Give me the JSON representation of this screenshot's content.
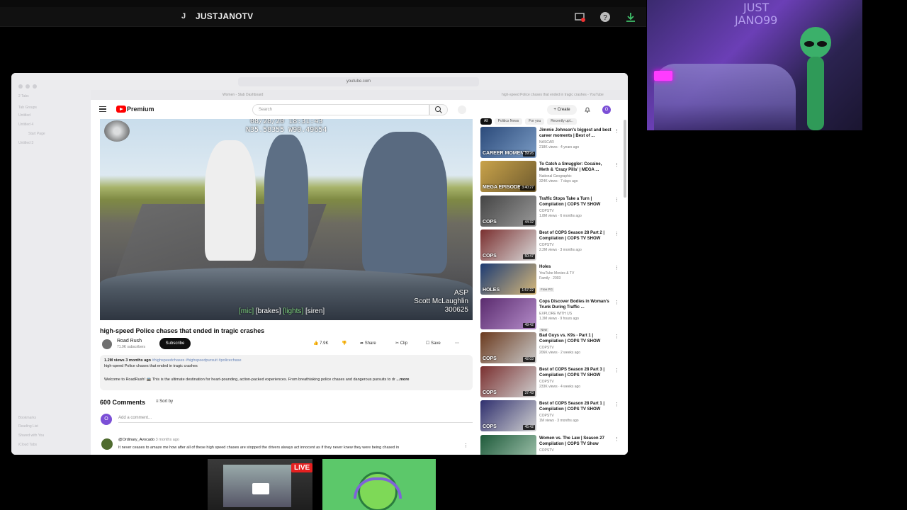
{
  "stream": {
    "channel_initial": "J",
    "channel_name": "JUSTJANOTV",
    "webcam_sign": "JUST\nJANO99",
    "live_label": "LIVE"
  },
  "browser": {
    "url": "youtube.com",
    "tabs": [
      "Women - Slab Dashboard",
      "high-speed Police chases that ended in tragic crashes - YouTube"
    ],
    "sidebar": [
      "2 Tabs",
      "Tab Groups",
      "Untitled",
      "Untitled 4",
      "Start Page",
      "Untitled 3",
      "Bookmarks",
      "Reading List",
      "Shared with You",
      "iCloud Tabs"
    ]
  },
  "youtube": {
    "brand": "Premium",
    "search_placeholder": "Search",
    "create_label": "Create",
    "avatar_initial": "O",
    "video": {
      "overlay_timestamp": "08/28/20 18:31:43",
      "overlay_gps": "N35.58355 W90.49654",
      "overlay_agency": "ASP",
      "overlay_officer": "Scott McLaughlin",
      "overlay_id": "300625",
      "captions": [
        "[mic]",
        "[brakes]",
        "[lights]",
        "[siren]"
      ],
      "title": "high-speed Police chases that ended in tragic crashes",
      "channel": "Road Rush",
      "subscribers": "71.9K subscribers",
      "subscribe_label": "Subscribe",
      "likes": "7.9K",
      "share_label": "Share",
      "clip_label": "Clip",
      "save_label": "Save",
      "views_age": "1.2M views  3 months ago",
      "hashtags": "#highspeedchases #highspeedpursuit #policechase",
      "desc_line2": "high-speed Police chases that ended in tragic crashes",
      "desc_line3": "Welcome to RoadRush! 🚔 This is the ultimate destination for heart-pounding, action-packed experiences. From breathtaking police chases and dangerous pursuits to dr",
      "more_label": "...more"
    },
    "comments": {
      "count": "600 Comments",
      "sort_label": "Sort by",
      "add_placeholder": "Add a comment...",
      "first": {
        "user": "@Ordinary_Avocado",
        "age": "3 months ago",
        "text": "It never ceases to amaze me how after all of these high speed chases are stopped the drivers always act innocent as if they never knew they were being chased in"
      }
    },
    "chips": [
      "All",
      "Politics News",
      "For you",
      "Recently upl..."
    ],
    "related": [
      {
        "title": "Jimmie Johnson's biggest and best career moments | Best of ...",
        "channel": "NASCAR",
        "meta": "218K views · 4 years ago",
        "duration": "39:26",
        "thumb_text": "CAREER MOMENTS",
        "c1": "#2b4a7a",
        "c2": "#7a9bc4"
      },
      {
        "title": "To Catch a Smuggler: Cocaine, Meth & 'Crazy Pills' | MEGA ...",
        "channel": "National Geographic",
        "meta": "324K views · 7 days ago",
        "duration": "3:40:27",
        "thumb_text": "MEGA EPISODE",
        "c1": "#c9a34a",
        "c2": "#6e5a2e"
      },
      {
        "title": "Traffic Stops Take a Turn | Compilation | COPS TV SHOW",
        "channel": "COPSTV",
        "meta": "1.8M views · 6 months ago",
        "duration": "44:32",
        "thumb_text": "COPS",
        "c1": "#444",
        "c2": "#999"
      },
      {
        "title": "Best of COPS Season 28 Part 2 | Compilation | COPS TV SHOW",
        "channel": "COPSTV",
        "meta": "2.2M views · 3 months ago",
        "duration": "50:47",
        "thumb_text": "COPS",
        "c1": "#7a2f2f",
        "c2": "#d9d9d9"
      },
      {
        "title": "Holes",
        "channel": "YouTube Movies & TV",
        "meta": "Family · 2003",
        "duration": "1:57:22",
        "thumb_text": "HOLES",
        "badge": "Free  PG",
        "c1": "#1d3b73",
        "c2": "#d6b87a"
      },
      {
        "title": "Cops Discover Bodies in Woman's Trunk During Traffic ...",
        "channel": "EXPLORE WITH US",
        "meta": "1.3M views · 9 hours ago",
        "duration": "49:42",
        "thumb_text": "",
        "badge": "New",
        "c1": "#5a2b6e",
        "c2": "#b48cc9"
      },
      {
        "title": "Bad Guys vs. K9s - Part 1 | Compilation | COPS TV SHOW",
        "channel": "COPSTV",
        "meta": "206K views · 2 weeks ago",
        "duration": "42:03",
        "thumb_text": "COPS",
        "c1": "#6b3a1e",
        "c2": "#c9c9c9"
      },
      {
        "title": "Best of COPS Season 28 Part 3 | Compilation | COPS TV SHOW",
        "channel": "COPSTV",
        "meta": "233K views · 4 weeks ago",
        "duration": "37:43",
        "thumb_text": "COPS",
        "c1": "#7a2f2f",
        "c2": "#cfcfcf"
      },
      {
        "title": "Best of COPS Season 28 Part 1 | Compilation | COPS TV SHOW",
        "channel": "COPSTV",
        "meta": "1M views · 3 months ago",
        "duration": "45:42",
        "thumb_text": "COPS",
        "c1": "#2f2f6e",
        "c2": "#d0d0d0"
      },
      {
        "title": "Women vs. The Law | Season 27 Compilation | COPS TV Show",
        "channel": "COPSTV",
        "meta": "",
        "duration": "",
        "thumb_text": "",
        "c1": "#1e5a3a",
        "c2": "#a8c9b4"
      }
    ]
  }
}
